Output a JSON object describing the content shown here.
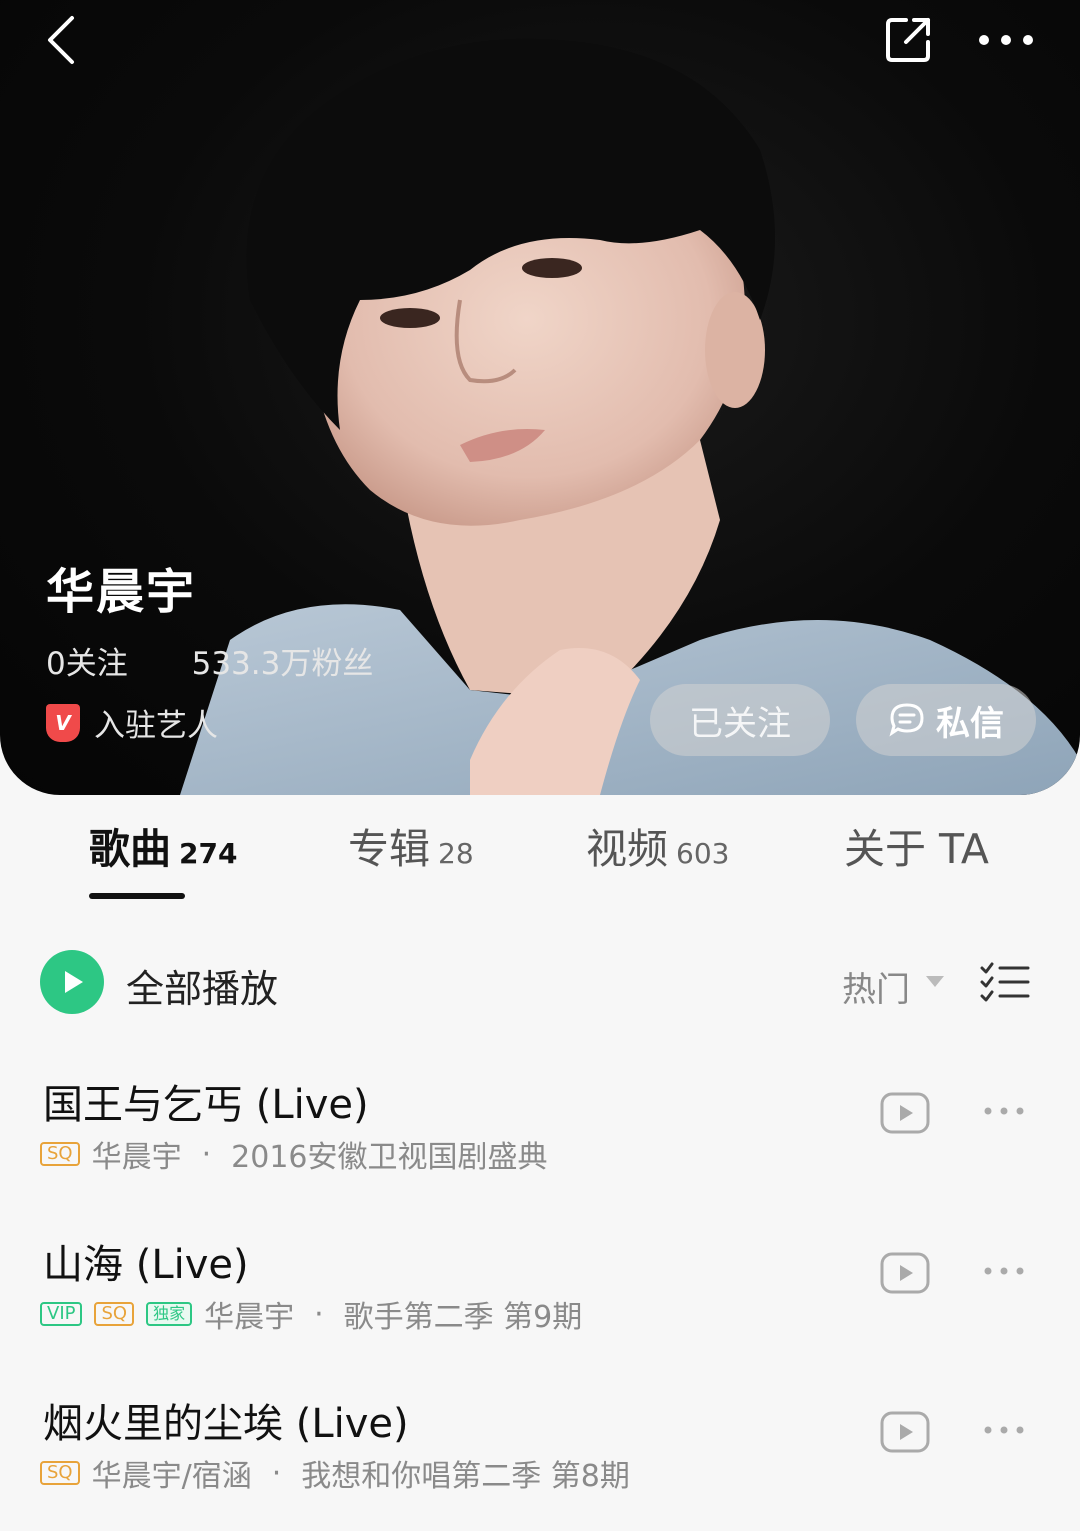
{
  "header": {
    "back_icon": "chevron-left-icon",
    "share_icon": "share-external-icon",
    "more_icon": "more-dots-icon"
  },
  "artist": {
    "name": "华晨宇",
    "following": "0关注",
    "fans": "533.3万粉丝",
    "badge_text": "V",
    "verified_label": "入驻艺人",
    "follow_button": "已关注",
    "message_button": "私信"
  },
  "tabs": [
    {
      "label": "歌曲",
      "count": "274",
      "active": true
    },
    {
      "label": "专辑",
      "count": "28",
      "active": false
    },
    {
      "label": "视频",
      "count": "603",
      "active": false
    },
    {
      "label": "关于 TA",
      "count": "",
      "active": false
    }
  ],
  "toolbar": {
    "play_all": "全部播放",
    "sort": "热门"
  },
  "songs": [
    {
      "title": "国王与乞丐 (Live)",
      "tags": [
        "SQ"
      ],
      "artist": "华晨宇",
      "album": "2016安徽卫视国剧盛典"
    },
    {
      "title": "山海 (Live)",
      "tags": [
        "VIP",
        "SQ",
        "独家"
      ],
      "artist": "华晨宇",
      "album": "歌手第二季 第9期"
    },
    {
      "title": "烟火里的尘埃 (Live)",
      "tags": [
        "SQ"
      ],
      "artist": "华晨宇/宿涵",
      "album": "我想和你唱第二季 第8期"
    }
  ],
  "colors": {
    "accent": "#2dc784",
    "sq": "#e8a33a",
    "badge_red": "#f04a4a"
  }
}
